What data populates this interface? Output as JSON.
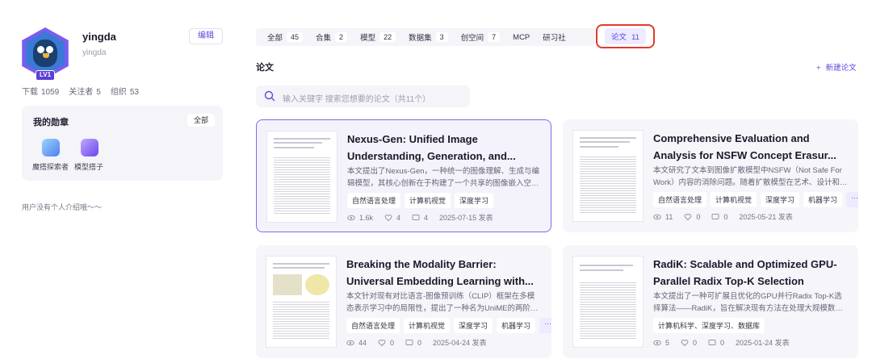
{
  "profile": {
    "username": "yingda",
    "handle": "yingda",
    "level": "LV1",
    "edit_label": "编辑",
    "stats": [
      {
        "label": "下载",
        "value": "1059"
      },
      {
        "label": "关注者",
        "value": "5"
      },
      {
        "label": "组织",
        "value": "53"
      }
    ],
    "badges": {
      "title": "我的勋章",
      "all_label": "全部",
      "items": [
        {
          "label": "魔搭探索者",
          "icon": "explorer-medal-icon"
        },
        {
          "label": "模型搭子",
          "icon": "model-buddy-medal-icon"
        }
      ]
    },
    "bio": "用户没有个人介绍哦～～"
  },
  "tabs": [
    {
      "label": "全部",
      "count": "45"
    },
    {
      "label": "合集",
      "count": "2"
    },
    {
      "label": "模型",
      "count": "22"
    },
    {
      "label": "数据集",
      "count": "3"
    },
    {
      "label": "创空间",
      "count": "7"
    },
    {
      "label": "MCP",
      "count": ""
    },
    {
      "label": "研习社",
      "count": ""
    }
  ],
  "active_tab": {
    "label": "论文",
    "count": "11"
  },
  "section": {
    "title": "论文",
    "new_label": "新建论文"
  },
  "search": {
    "placeholder": "输入关键字 搜索您想要的论文（共11个）"
  },
  "papers": [
    {
      "title": "Nexus-Gen: Unified Image Understanding, Generation, and...",
      "desc": "本文提出了Nexus-Gen，一种统一的图像理解、生成与编辑模型，其核心创新在于构建了一个共享的图像嵌入空间，将...",
      "tags": [
        "自然语言处理",
        "计算机视觉",
        "深度学习"
      ],
      "more": "",
      "views": "1.6k",
      "likes": "4",
      "comments": "4",
      "date": "2025-07-15 发表"
    },
    {
      "title": "Comprehensive Evaluation and Analysis for NSFW Concept Erasur...",
      "desc": "本文研究了文本到图像扩散模型中NSFW（Not Safe For Work）内容的消除问题。随着扩散模型在艺术、设计和商...",
      "tags": [
        "自然语言处理",
        "计算机视觉",
        "深度学习",
        "机器学习"
      ],
      "more": "···",
      "views": "11",
      "likes": "0",
      "comments": "0",
      "date": "2025-05-21 发表"
    },
    {
      "title": "Breaking the Modality Barrier: Universal Embedding Learning with...",
      "desc": "本文针对现有对比语言-图像预训练（CLIP）框架在多模态表示学习中的局限性，提出了一种名为UniME的两阶段框架。...",
      "tags": [
        "自然语言处理",
        "计算机视觉",
        "深度学习",
        "机器学习"
      ],
      "more": "···",
      "views": "44",
      "likes": "0",
      "comments": "0",
      "date": "2025-04-24 发表"
    },
    {
      "title": "RadiK: Scalable and Optimized GPU-Parallel Radix Top-K Selection",
      "desc": "本文提出了一种可扩展且优化的GPU并行Radix Top-K选择算法——RadiK，旨在解决现有方法在处理大规模数据时受限...",
      "tags": [
        "计算机科学、深度学习、数据库"
      ],
      "more": "",
      "views": "5",
      "likes": "0",
      "comments": "0",
      "date": "2025-01-24 发表"
    }
  ],
  "colors": {
    "accent": "#5b4bde",
    "highlight": "#e33a2b",
    "card_bg": "#f5f5fa"
  }
}
